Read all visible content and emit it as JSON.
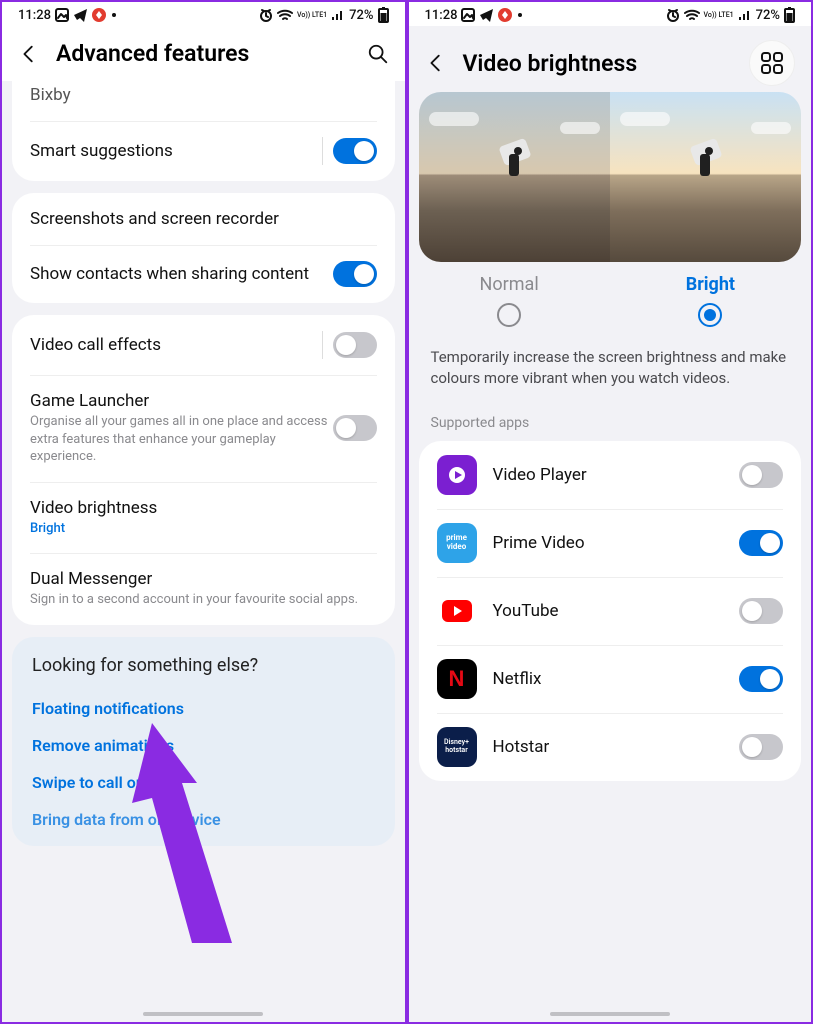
{
  "status": {
    "time": "11:28",
    "battery": "72%",
    "net_label": "Vo)) LTE1"
  },
  "left": {
    "title": "Advanced features",
    "rows": {
      "bixby": "Bixby",
      "smart": "Smart suggestions",
      "screenrec": "Screenshots and screen recorder",
      "contacts": "Show contacts when sharing content",
      "vcall": "Video call effects",
      "launcher_t": "Game Launcher",
      "launcher_s": "Organise all your games all in one place and access extra features that enhance your gameplay experience.",
      "vbright_t": "Video brightness",
      "vbright_s": "Bright",
      "dual_t": "Dual Messenger",
      "dual_s": "Sign in to a second account in your favourite social apps."
    },
    "sugg": {
      "head": "Looking for something else?",
      "l1": "Floating notifications",
      "l2": "Remove animations",
      "l3": "Swipe to call or text",
      "l4": "Bring data from old device"
    }
  },
  "right": {
    "title": "Video brightness",
    "mode_normal": "Normal",
    "mode_bright": "Bright",
    "desc": "Temporarily increase the screen brightness and make colours more vibrant when you watch videos.",
    "section": "Supported apps",
    "apps": {
      "vp": "Video Player",
      "pv": "Prime Video",
      "yt": "YouTube",
      "nf": "Netflix",
      "hs": "Hotstar"
    }
  }
}
